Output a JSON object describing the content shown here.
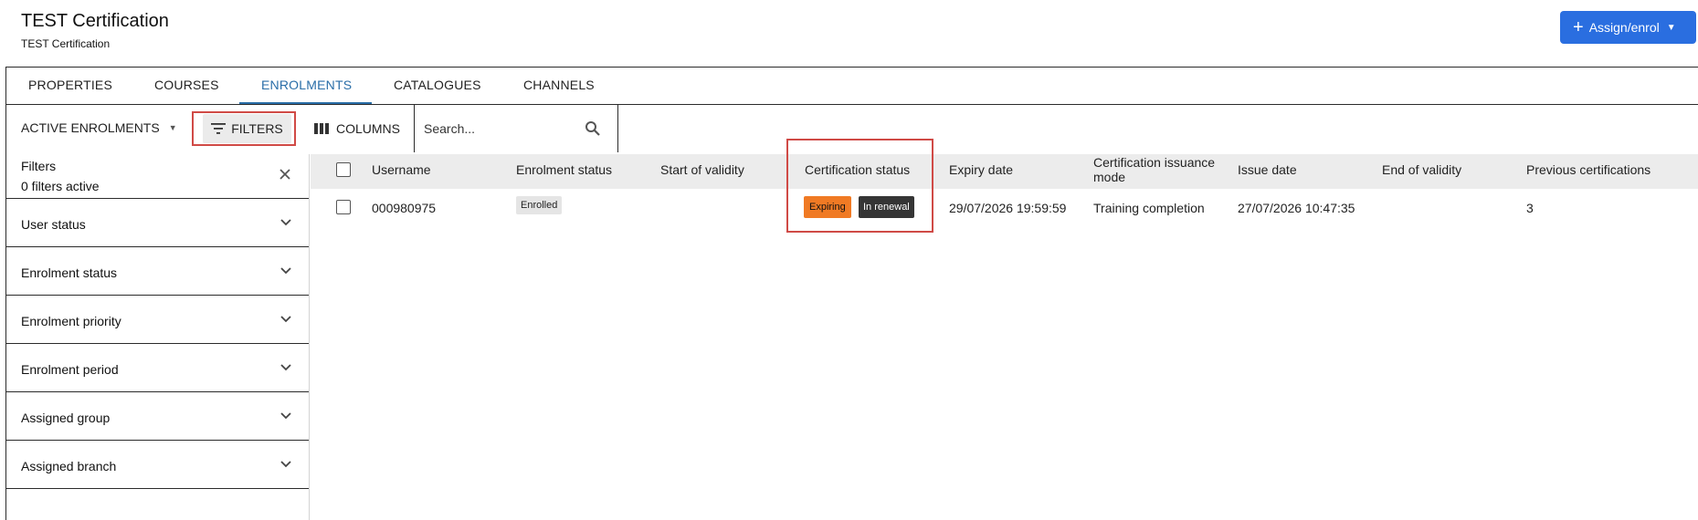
{
  "header": {
    "title": "TEST Certification",
    "subtitle": "TEST Certification",
    "assign_label": "Assign/enrol",
    "accent_color": "#2a6ee0"
  },
  "tabs": [
    {
      "label": "PROPERTIES",
      "active": false
    },
    {
      "label": "COURSES",
      "active": false
    },
    {
      "label": "ENROLMENTS",
      "active": true
    },
    {
      "label": "CATALOGUES",
      "active": false
    },
    {
      "label": "CHANNELS",
      "active": false
    }
  ],
  "toolbar": {
    "view_label": "ACTIVE ENROLMENTS",
    "filters_label": "FILTERS",
    "columns_label": "COLUMNS",
    "search_placeholder": "Search..."
  },
  "filters": {
    "title": "Filters",
    "active_count_text": "0 filters active",
    "sections": [
      "User status",
      "Enrolment status",
      "Enrolment priority",
      "Enrolment period",
      "Assigned group",
      "Assigned branch"
    ]
  },
  "table": {
    "columns": [
      "Username",
      "Enrolment status",
      "Start of validity",
      "Certification status",
      "Expiry date",
      "Certification issuance mode",
      "Issue date",
      "End of validity",
      "Previous certifications"
    ],
    "rows": [
      {
        "username": "000980975",
        "enrolment_status": "Enrolled",
        "start_of_validity": "",
        "certification_status": [
          "Expiring",
          "In renewal"
        ],
        "expiry_date": "29/07/2026 19:59:59",
        "issuance_mode": "Training completion",
        "issue_date": "27/07/2026 10:47:35",
        "end_of_validity": "",
        "previous_certifications": "3"
      }
    ]
  },
  "highlight_color": "#d04a46",
  "badge_colors": {
    "expiring": "#f07a24",
    "in_renewal": "#353535"
  }
}
